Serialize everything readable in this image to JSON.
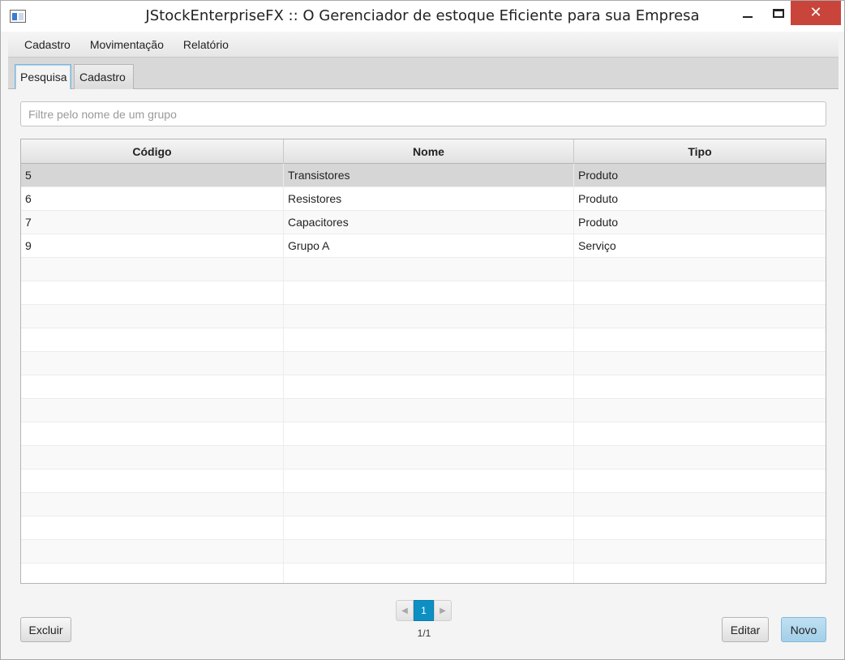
{
  "window": {
    "title": "JStockEnterpriseFX :: O Gerenciador de estoque Eficiente para sua Empresa",
    "app_icon": "window-app-icon",
    "controls": {
      "minimize_icon": "minimize-icon",
      "maximize_icon": "maximize-icon",
      "close_icon": "close-icon",
      "close_glyph": "✕"
    }
  },
  "menubar": {
    "items": [
      {
        "label": "Cadastro"
      },
      {
        "label": "Movimentação"
      },
      {
        "label": "Relatório"
      }
    ]
  },
  "tabs": [
    {
      "label": "Pesquisa",
      "active": true
    },
    {
      "label": "Cadastro",
      "active": false
    }
  ],
  "filter": {
    "value": "",
    "placeholder": "Filtre pelo nome de um grupo"
  },
  "table": {
    "columns": [
      "Código",
      "Nome",
      "Tipo"
    ],
    "rows": [
      {
        "codigo": "5",
        "nome": "Transistores",
        "tipo": "Produto",
        "selected": true
      },
      {
        "codigo": "6",
        "nome": "Resistores",
        "tipo": "Produto",
        "selected": false
      },
      {
        "codigo": "7",
        "nome": "Capacitores",
        "tipo": "Produto",
        "selected": false
      },
      {
        "codigo": "9",
        "nome": "Grupo A",
        "tipo": "Serviço",
        "selected": false
      }
    ],
    "empty_rows": 14
  },
  "pagination": {
    "prev_glyph": "◀",
    "next_glyph": "▶",
    "current_page": "1",
    "info": "1/1"
  },
  "buttons": {
    "excluir": "Excluir",
    "editar": "Editar",
    "novo": "Novo"
  },
  "colors": {
    "accent": "#0c90c4",
    "close_button": "#c9443a",
    "default_button": "#a3cfe8",
    "selected_row": "#d6d6d6"
  }
}
